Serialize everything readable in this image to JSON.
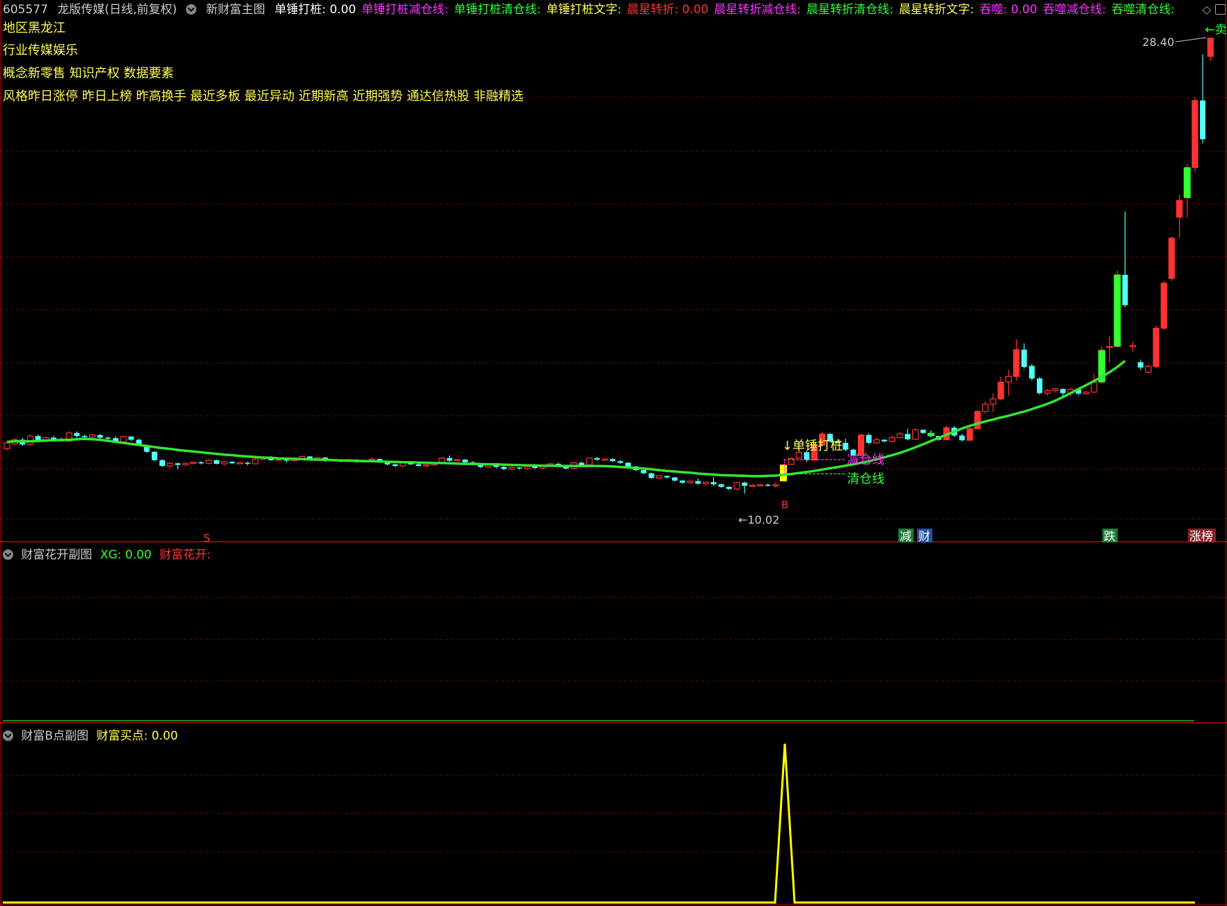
{
  "header": {
    "stock_code": "605577",
    "stock_name": "龙版传媒(日线,前复权)",
    "indicator_name": "新财富主图",
    "items": [
      {
        "label": "单锤打桩: 0.00",
        "color": "#ffffff"
      },
      {
        "label": "单锤打桩减仓线:",
        "color": "#ff33ff"
      },
      {
        "label": "单锤打桩清仓线:",
        "color": "#33ff33"
      },
      {
        "label": "单锤打桩文字:",
        "color": "#ffff55"
      },
      {
        "label": "晨星转折: 0.00",
        "color": "#ff3333"
      },
      {
        "label": "晨星转折减仓线:",
        "color": "#ff33ff"
      },
      {
        "label": "晨星转折清仓线:",
        "color": "#33ff33"
      },
      {
        "label": "晨星转折文字:",
        "color": "#ffff55"
      },
      {
        "label": "吞噬: 0.00",
        "color": "#ff33ff"
      },
      {
        "label": "吞噬减仓线:",
        "color": "#ff33ff"
      },
      {
        "label": "吞噬清仓线:",
        "color": "#33ff33"
      }
    ],
    "right_icons": "◇"
  },
  "info": {
    "region": "地区黑龙江",
    "industry": "行业传媒娱乐",
    "concept": "概念新零售 知识产权 数据要素",
    "style": "风格昨日涨停 昨日上榜 昨高换手 最近多板 最近异动 近期新高 近期强势 通达信热股 非融精选"
  },
  "chart_labels": {
    "high_price": "28.40",
    "low_price": "10.02",
    "sell_label": "←卖出",
    "hammer_label": "↓单锤打桩",
    "reduce_line": "减仓线",
    "clear_line": "清仓线",
    "buy_marker": "B",
    "s_marker": "S",
    "tags": [
      {
        "text": "减",
        "bg": "#1f7a3a"
      },
      {
        "text": "财",
        "bg": "#2a4fa0"
      },
      {
        "text": "跌",
        "bg": "#1f7a3a"
      },
      {
        "text": "涨榜",
        "bg": "#8a1f2a"
      }
    ]
  },
  "sub1": {
    "name": "财富花开副图",
    "xg": "XG: 0.00",
    "label": "财富花开:"
  },
  "sub2": {
    "name": "财富B点副图",
    "label": "财富买点: 0.00"
  },
  "colors": {
    "up": "#ff3232",
    "down": "#54ffff",
    "ma": "#32e632",
    "grid": "#8b0000",
    "buy_line": "#ffff00"
  },
  "chart_data": {
    "type": "candlestick",
    "price_range": [
      10.02,
      28.4
    ],
    "candles": [
      [
        12.7,
        12.92,
        12.62,
        12.96
      ],
      [
        12.88,
        13.04,
        12.84,
        13.1
      ],
      [
        13.04,
        12.86,
        12.8,
        13.12
      ],
      [
        12.86,
        13.18,
        12.8,
        13.24
      ],
      [
        13.18,
        12.98,
        12.94,
        13.24
      ],
      [
        12.98,
        13.12,
        12.96,
        13.16
      ],
      [
        13.12,
        13.06,
        13.04,
        13.18
      ],
      [
        13.06,
        12.98,
        12.96,
        13.12
      ],
      [
        12.98,
        13.3,
        12.96,
        13.38
      ],
      [
        13.3,
        13.18,
        13.12,
        13.36
      ],
      [
        13.18,
        13.14,
        13.1,
        13.24
      ],
      [
        13.14,
        13.22,
        13.1,
        13.26
      ],
      [
        13.22,
        13.12,
        13.06,
        13.26
      ],
      [
        13.12,
        13.1,
        13.04,
        13.16
      ],
      [
        13.1,
        12.96,
        12.94,
        13.18
      ],
      [
        12.96,
        13.16,
        12.92,
        13.2
      ],
      [
        13.16,
        13.04,
        13.0,
        13.18
      ],
      [
        13.04,
        12.84,
        12.82,
        13.08
      ],
      [
        12.84,
        12.58,
        12.54,
        12.86
      ],
      [
        12.58,
        12.26,
        12.22,
        12.6
      ],
      [
        12.26,
        12.04,
        12.0,
        12.3
      ],
      [
        12.04,
        12.14,
        11.96,
        12.18
      ],
      [
        12.14,
        12.08,
        11.92,
        12.16
      ],
      [
        12.08,
        12.14,
        12.04,
        12.18
      ],
      [
        12.14,
        12.18,
        12.1,
        12.2
      ],
      [
        12.18,
        12.14,
        12.1,
        12.22
      ],
      [
        12.14,
        12.26,
        12.1,
        12.3
      ],
      [
        12.26,
        12.12,
        12.1,
        12.28
      ],
      [
        12.12,
        12.2,
        12.06,
        12.22
      ],
      [
        12.2,
        12.14,
        12.12,
        12.22
      ],
      [
        12.14,
        12.16,
        12.1,
        12.18
      ],
      [
        12.16,
        12.12,
        12.06,
        12.2
      ],
      [
        12.12,
        12.3,
        12.1,
        12.34
      ],
      [
        12.3,
        12.38,
        12.26,
        12.42
      ],
      [
        12.38,
        12.26,
        12.24,
        12.42
      ],
      [
        12.26,
        12.3,
        12.22,
        12.32
      ],
      [
        12.3,
        12.24,
        12.18,
        12.32
      ],
      [
        12.24,
        12.32,
        12.2,
        12.36
      ],
      [
        12.32,
        12.4,
        12.28,
        12.44
      ],
      [
        12.4,
        12.3,
        12.26,
        12.42
      ],
      [
        12.3,
        12.36,
        12.28,
        12.38
      ],
      [
        12.36,
        12.24,
        12.2,
        12.38
      ],
      [
        12.24,
        12.28,
        12.2,
        12.32
      ],
      [
        12.28,
        12.22,
        12.18,
        12.3
      ],
      [
        12.22,
        12.28,
        12.18,
        12.32
      ],
      [
        12.28,
        12.2,
        12.16,
        12.3
      ],
      [
        12.2,
        12.26,
        12.16,
        12.28
      ],
      [
        12.26,
        12.3,
        12.22,
        12.36
      ],
      [
        12.3,
        12.2,
        12.16,
        12.32
      ],
      [
        12.2,
        12.1,
        12.06,
        12.22
      ],
      [
        12.1,
        12.04,
        12.0,
        12.12
      ],
      [
        12.04,
        12.16,
        12.0,
        12.2
      ],
      [
        12.16,
        12.1,
        12.08,
        12.18
      ],
      [
        12.1,
        12.04,
        12.02,
        12.14
      ],
      [
        12.04,
        12.08,
        12.0,
        12.1
      ],
      [
        12.08,
        12.16,
        12.04,
        12.2
      ],
      [
        12.16,
        12.34,
        12.12,
        12.38
      ],
      [
        12.34,
        12.24,
        12.2,
        12.44
      ],
      [
        12.24,
        12.28,
        12.2,
        12.3
      ],
      [
        12.28,
        12.18,
        12.14,
        12.3
      ],
      [
        12.18,
        12.1,
        12.06,
        12.22
      ],
      [
        12.1,
        12.0,
        11.96,
        12.12
      ],
      [
        12.0,
        12.1,
        11.96,
        12.14
      ],
      [
        12.1,
        12.0,
        11.96,
        12.12
      ],
      [
        12.0,
        11.92,
        11.88,
        12.04
      ],
      [
        11.92,
        11.98,
        11.88,
        12.02
      ],
      [
        11.98,
        11.94,
        11.9,
        12.0
      ],
      [
        11.94,
        12.02,
        11.9,
        12.06
      ],
      [
        12.02,
        11.96,
        11.92,
        12.06
      ],
      [
        11.96,
        12.04,
        11.92,
        12.08
      ],
      [
        12.04,
        12.12,
        12.0,
        12.16
      ],
      [
        12.12,
        12.04,
        12.0,
        12.16
      ],
      [
        12.04,
        11.94,
        11.9,
        12.08
      ],
      [
        11.94,
        12.16,
        11.9,
        12.2
      ],
      [
        12.16,
        12.08,
        12.02,
        12.2
      ],
      [
        12.08,
        12.34,
        12.04,
        12.36
      ],
      [
        12.34,
        12.28,
        12.24,
        12.38
      ],
      [
        12.28,
        12.3,
        12.24,
        12.32
      ],
      [
        12.3,
        12.22,
        12.2,
        12.34
      ],
      [
        12.22,
        12.16,
        12.12,
        12.26
      ],
      [
        12.16,
        12.02,
        11.98,
        12.18
      ],
      [
        12.02,
        11.88,
        11.84,
        12.04
      ],
      [
        11.88,
        11.76,
        11.72,
        11.9
      ],
      [
        11.76,
        11.58,
        11.54,
        11.78
      ],
      [
        11.58,
        11.66,
        11.54,
        11.68
      ],
      [
        11.66,
        11.6,
        11.56,
        11.68
      ],
      [
        11.6,
        11.48,
        11.44,
        11.62
      ],
      [
        11.48,
        11.4,
        11.36,
        11.5
      ],
      [
        11.4,
        11.46,
        11.36,
        11.48
      ],
      [
        11.46,
        11.36,
        11.32,
        11.56
      ],
      [
        11.36,
        11.42,
        11.32,
        11.44
      ],
      [
        11.42,
        11.34,
        11.28,
        11.62
      ],
      [
        11.34,
        11.24,
        11.2,
        11.36
      ],
      [
        11.24,
        11.16,
        11.12,
        11.26
      ],
      [
        11.16,
        11.4,
        11.12,
        11.44
      ],
      [
        11.4,
        11.28,
        10.98,
        11.44
      ],
      [
        11.28,
        11.3,
        11.24,
        11.34
      ],
      [
        11.3,
        11.32,
        11.26,
        11.36
      ],
      [
        11.32,
        11.3,
        11.26,
        11.36
      ],
      [
        11.3,
        11.32,
        11.22,
        11.42
      ],
      [
        11.46,
        12.08,
        11.44,
        12.12
      ],
      [
        12.1,
        12.32,
        12.08,
        12.38
      ],
      [
        12.34,
        12.56,
        12.32,
        12.72
      ],
      [
        12.56,
        12.26,
        12.2,
        12.62
      ],
      [
        12.26,
        12.84,
        12.22,
        12.9
      ],
      [
        12.84,
        13.26,
        12.8,
        13.36
      ],
      [
        13.26,
        12.98,
        12.94,
        13.3
      ],
      [
        12.98,
        12.92,
        12.88,
        13.04
      ],
      [
        12.92,
        12.66,
        12.6,
        13.08
      ],
      [
        12.66,
        12.44,
        12.4,
        12.7
      ],
      [
        12.44,
        13.22,
        12.4,
        13.28
      ],
      [
        13.22,
        12.92,
        12.86,
        13.28
      ],
      [
        12.92,
        13.04,
        12.88,
        13.12
      ],
      [
        13.04,
        12.98,
        12.94,
        13.06
      ],
      [
        12.98,
        13.12,
        12.94,
        13.2
      ],
      [
        13.12,
        13.26,
        13.1,
        13.34
      ],
      [
        13.26,
        13.06,
        13.02,
        13.46
      ],
      [
        13.06,
        13.42,
        13.04,
        13.48
      ],
      [
        13.42,
        13.3,
        13.26,
        13.44
      ],
      [
        13.3,
        13.18,
        13.12,
        13.4
      ],
      [
        13.18,
        13.04,
        13.0,
        13.2
      ],
      [
        13.04,
        13.5,
        13.02,
        13.58
      ],
      [
        13.5,
        13.2,
        13.14,
        13.56
      ],
      [
        13.2,
        13.02,
        12.98,
        13.26
      ],
      [
        13.02,
        13.46,
        13.0,
        13.52
      ],
      [
        13.46,
        14.12,
        13.42,
        14.18
      ],
      [
        14.12,
        14.4,
        14.04,
        14.5
      ],
      [
        14.4,
        14.6,
        14.1,
        14.82
      ],
      [
        14.6,
        15.24,
        14.54,
        15.44
      ],
      [
        15.24,
        15.46,
        14.72,
        15.7
      ],
      [
        15.46,
        16.48,
        15.3,
        16.88
      ],
      [
        16.48,
        15.82,
        15.76,
        16.72
      ],
      [
        15.86,
        15.38,
        15.3,
        15.92
      ],
      [
        15.38,
        14.82,
        14.76,
        15.44
      ],
      [
        14.82,
        14.92,
        14.72,
        14.98
      ],
      [
        14.92,
        14.98,
        14.84,
        15.02
      ],
      [
        14.98,
        14.82,
        14.7,
        15.0
      ],
      [
        14.82,
        14.96,
        14.7,
        15.02
      ],
      [
        14.96,
        14.8,
        14.76,
        15.0
      ],
      [
        14.8,
        14.86,
        14.76,
        14.9
      ],
      [
        14.86,
        15.24,
        14.82,
        15.56
      ],
      [
        15.24,
        16.46,
        15.18,
        16.6
      ],
      [
        16.56,
        16.6,
        16.0,
        17.0
      ],
      [
        16.6,
        19.34,
        16.56,
        19.5
      ],
      [
        19.34,
        18.18,
        18.1,
        21.76
      ],
      [
        16.62,
        16.64,
        16.4,
        16.8
      ],
      [
        16.0,
        15.8,
        15.7,
        16.1
      ],
      [
        15.62,
        15.84,
        15.58,
        15.9
      ],
      [
        15.84,
        17.3,
        15.78,
        17.4
      ],
      [
        17.3,
        19.02,
        17.24,
        19.1
      ],
      [
        19.2,
        20.74,
        19.1,
        20.8
      ],
      [
        21.54,
        22.18,
        20.76,
        22.4
      ],
      [
        22.28,
        23.44,
        21.52,
        23.58
      ],
      [
        23.44,
        26.0,
        23.28,
        26.12
      ],
      [
        26.0,
        24.52,
        24.36,
        27.76
      ],
      [
        27.68,
        28.38,
        27.5,
        28.4
      ]
    ],
    "ma_line": [
      12.96,
      12.98,
      12.98,
      12.98,
      12.99,
      13.01,
      13.02,
      13.03,
      13.04,
      13.06,
      13.07,
      13.06,
      13.04,
      13.0,
      12.96,
      12.92,
      12.88,
      12.84,
      12.8,
      12.76,
      12.72,
      12.69,
      12.65,
      12.62,
      12.59,
      12.56,
      12.53,
      12.5,
      12.47,
      12.45,
      12.42,
      12.4,
      12.38,
      12.36,
      12.35,
      12.33,
      12.32,
      12.31,
      12.3,
      12.29,
      12.28,
      12.27,
      12.26,
      12.25,
      12.24,
      12.23,
      12.22,
      12.22,
      12.21,
      12.2,
      12.19,
      12.18,
      12.18,
      12.17,
      12.16,
      12.15,
      12.15,
      12.14,
      12.13,
      12.12,
      12.12,
      12.11,
      12.1,
      12.1,
      12.09,
      12.08,
      12.07,
      12.06,
      12.06,
      12.05,
      12.05,
      12.04,
      12.04,
      12.04,
      12.04,
      12.04,
      12.04,
      12.03,
      12.02,
      12.0,
      11.98,
      11.96,
      11.94,
      11.91,
      11.88,
      11.85,
      11.83,
      11.8,
      11.78,
      11.75,
      11.73,
      11.71,
      11.69,
      11.68,
      11.67,
      11.66,
      11.65,
      11.65,
      11.66,
      11.67,
      11.7,
      11.73,
      11.77,
      11.81,
      11.85,
      11.9,
      11.95,
      12.0,
      12.05,
      12.1,
      12.16,
      12.22,
      12.29,
      12.37,
      12.45,
      12.54,
      12.64,
      12.75,
      12.87,
      12.99,
      13.11,
      13.23,
      13.35,
      13.47,
      13.57,
      13.66,
      13.74,
      13.81,
      13.89,
      13.96,
      14.04,
      14.12,
      14.21,
      14.31,
      14.41,
      14.53,
      14.67,
      14.82,
      14.98,
      15.13,
      15.28,
      15.44,
      15.62,
      15.82,
      16.05
    ],
    "buy_signal_index": 100
  }
}
